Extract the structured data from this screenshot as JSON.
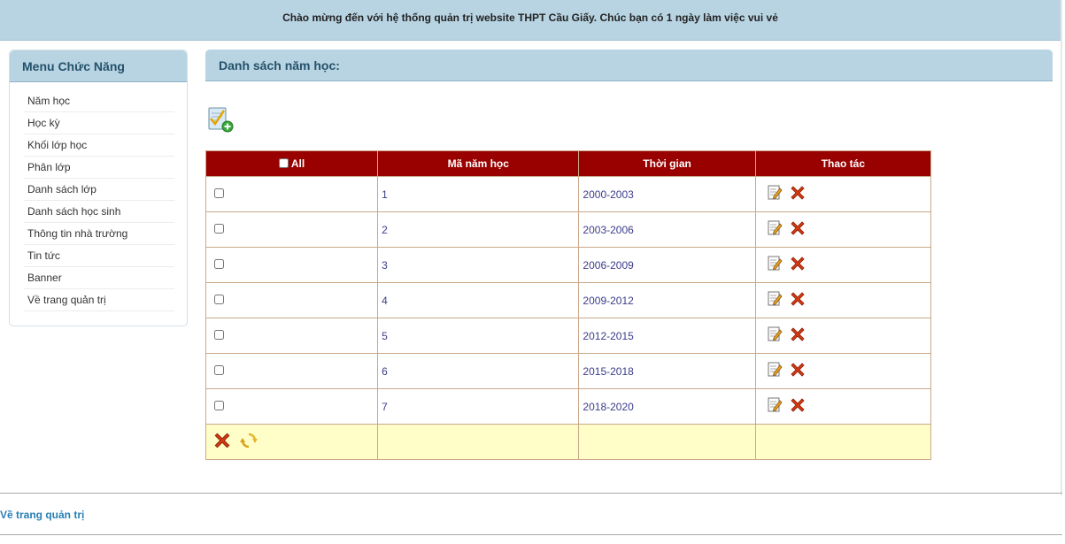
{
  "banner": {
    "text": "Chào mừng đến với hệ thống quản trị website THPT Cầu Giấy. Chúc bạn có 1 ngày làm việc vui vẻ"
  },
  "sidebar": {
    "title": "Menu Chức Năng",
    "items": [
      {
        "label": "Năm học"
      },
      {
        "label": "Học kỳ"
      },
      {
        "label": "Khối lớp học"
      },
      {
        "label": "Phân lớp"
      },
      {
        "label": "Danh sách lớp"
      },
      {
        "label": "Danh sách học sinh"
      },
      {
        "label": "Thông tin nhà trường"
      },
      {
        "label": "Tin tức"
      },
      {
        "label": "Banner"
      },
      {
        "label": "Về trang quản trị"
      }
    ]
  },
  "content": {
    "title": "Danh sách năm học:",
    "add_icon": "add-document-icon",
    "columns": {
      "all": "All",
      "code": "Mã năm học",
      "time": "Thời gian",
      "actions": "Thao tác"
    },
    "rows": [
      {
        "code": "1",
        "time": "2000-2003"
      },
      {
        "code": "2",
        "time": "2003-2006"
      },
      {
        "code": "3",
        "time": "2006-2009"
      },
      {
        "code": "4",
        "time": "2009-2012"
      },
      {
        "code": "5",
        "time": "2012-2015"
      },
      {
        "code": "6",
        "time": "2015-2018"
      },
      {
        "code": "7",
        "time": "2018-2020"
      }
    ],
    "row_icons": {
      "edit": "edit-icon",
      "delete": "delete-icon"
    },
    "footer_icons": {
      "delete": "delete-icon",
      "refresh": "refresh-icon"
    }
  },
  "footer": {
    "link": "Về trang quản trị"
  },
  "colors": {
    "header_bg": "#b8d4e3",
    "table_header_bg": "#990000",
    "footer_row_bg": "#fffec8",
    "link": "#2a7fb5",
    "delete": "#d23a12"
  }
}
